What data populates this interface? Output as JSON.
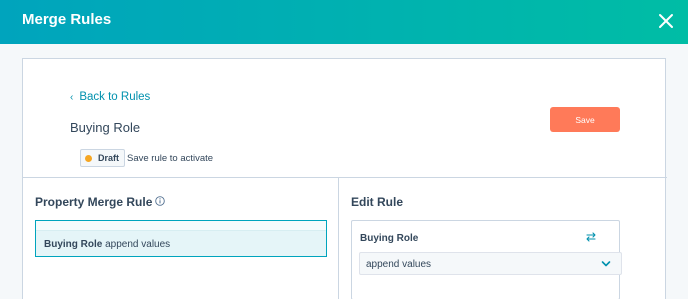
{
  "header": {
    "title": "Merge Rules"
  },
  "editor": {
    "back_label": "Back to Rules",
    "rule_title": "Buying Role",
    "save_label": "Save",
    "draft_label": "Draft",
    "draft_note": "Save rule to activate"
  },
  "left_panel": {
    "title": "Property Merge Rule",
    "rules": [
      {
        "property": "Buying Role",
        "action": "append values"
      }
    ]
  },
  "right_panel": {
    "title": "Edit Rule",
    "property": "Buying Role",
    "selected_action": "append values"
  },
  "colors": {
    "header_start": "#00a4bd",
    "header_end": "#00bda5",
    "save_button": "#ff7a59",
    "link": "#0091ae",
    "draft_dot": "#f5a623"
  }
}
